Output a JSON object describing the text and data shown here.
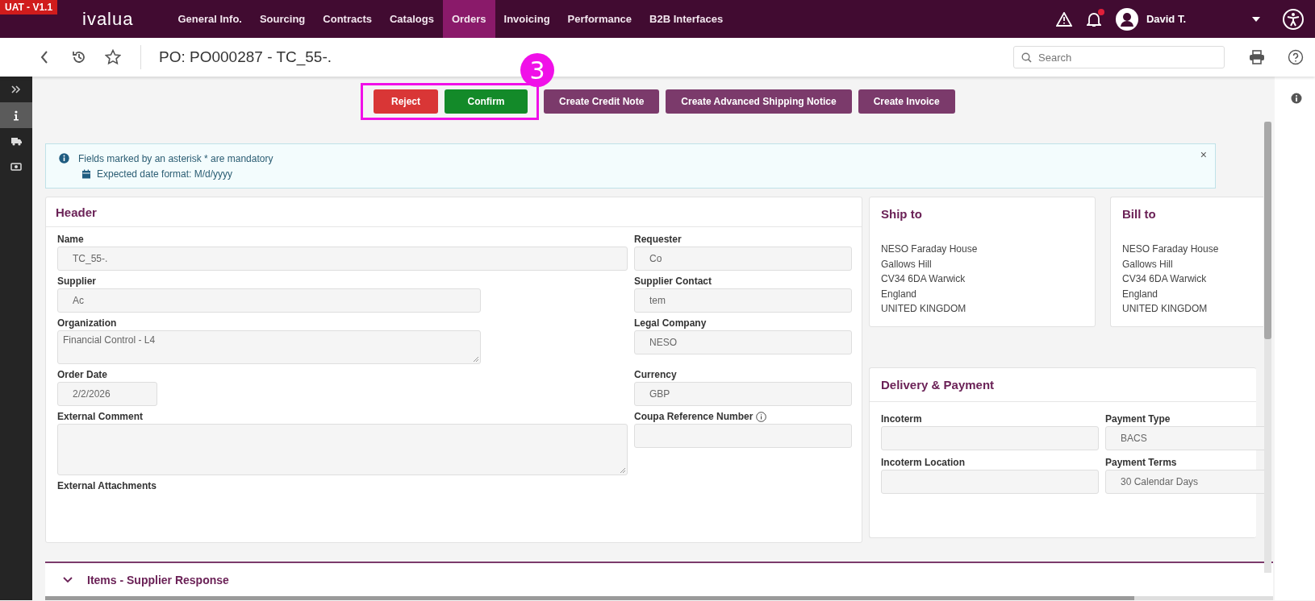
{
  "top_bar": {
    "env_badge": "UAT - V1.1",
    "logo": "ivalua",
    "nav": [
      {
        "label": "General Info.",
        "selected": false
      },
      {
        "label": "Sourcing",
        "selected": false
      },
      {
        "label": "Contracts",
        "selected": false
      },
      {
        "label": "Catalogs",
        "selected": false
      },
      {
        "label": "Orders",
        "selected": true
      },
      {
        "label": "Invoicing",
        "selected": false
      },
      {
        "label": "Performance",
        "selected": false
      },
      {
        "label": "B2B Interfaces",
        "selected": false
      }
    ],
    "notification_dot": true,
    "user": "David T."
  },
  "sub_bar": {
    "title": "PO: PO000287 - TC_55-.",
    "search": {
      "placeholder": "Search"
    }
  },
  "side_rail": [
    {
      "selected": false
    },
    {
      "selected": true
    },
    {
      "selected": false
    },
    {
      "selected": false
    }
  ],
  "actions": [
    {
      "label": "Reject",
      "kind": "reject",
      "annotated": true
    },
    {
      "label": "Confirm",
      "kind": "confirm",
      "annotated": true
    },
    {
      "label": "Create Credit Note",
      "kind": "default",
      "annotated": false
    },
    {
      "label": "Create Advanced Shipping Notice",
      "kind": "default",
      "annotated": false
    },
    {
      "label": "Create Invoice",
      "kind": "default",
      "annotated": false
    }
  ],
  "annotation": {
    "label": "3"
  },
  "info_banner": {
    "messages": [
      "Fields marked by an asterisk * are mandatory",
      "Expected date format: M/d/yyyy"
    ],
    "close": "×"
  },
  "header": {
    "title": "Header",
    "rows": [
      [
        {
          "label": "Name",
          "value": "TC_55-.",
          "kind": "input"
        },
        {
          "label": "Requester",
          "value": "Co",
          "kind": "input"
        }
      ],
      [
        {
          "label": "Supplier",
          "value": "Ac",
          "kind": "input"
        },
        {
          "label": "Supplier Contact",
          "value": "tem",
          "kind": "input"
        }
      ],
      [
        {
          "label": "Organization",
          "value": "Financial Control - L4",
          "kind": "textarea"
        },
        {
          "label": "Legal Company",
          "value": "NESO",
          "kind": "input"
        }
      ],
      [
        {
          "label": "Order Date",
          "value": "2/2/2026",
          "kind": "input"
        },
        {
          "label": "Currency",
          "value": "GBP",
          "kind": "input"
        }
      ],
      [
        {
          "label": "External Comment",
          "kind": "textarea"
        },
        {
          "label": "Coupa Reference Number",
          "kind": "input",
          "info": true
        }
      ],
      [
        {
          "label": "External Attachments",
          "kind": "label"
        }
      ]
    ]
  },
  "ship_to": {
    "title": "Ship to",
    "lines": [
      "NESO Faraday House",
      "Gallows Hill",
      "CV34 6DA Warwick",
      "England",
      "UNITED KINGDOM"
    ]
  },
  "bill_to": {
    "title": "Bill to",
    "lines": [
      "NESO Faraday House",
      "Gallows Hill",
      "CV34 6DA Warwick",
      "England",
      "UNITED KINGDOM"
    ]
  },
  "delivery_payment": {
    "title": "Delivery & Payment",
    "fields": [
      {
        "label": "Incoterm"
      },
      {
        "label": "Payment Type",
        "value": "BACS"
      },
      {
        "label": "Incoterm Location"
      },
      {
        "label": "Payment Terms",
        "value": "30 Calendar Days"
      }
    ]
  },
  "items_section": {
    "title": "Items - Supplier Response",
    "expanded": true
  }
}
